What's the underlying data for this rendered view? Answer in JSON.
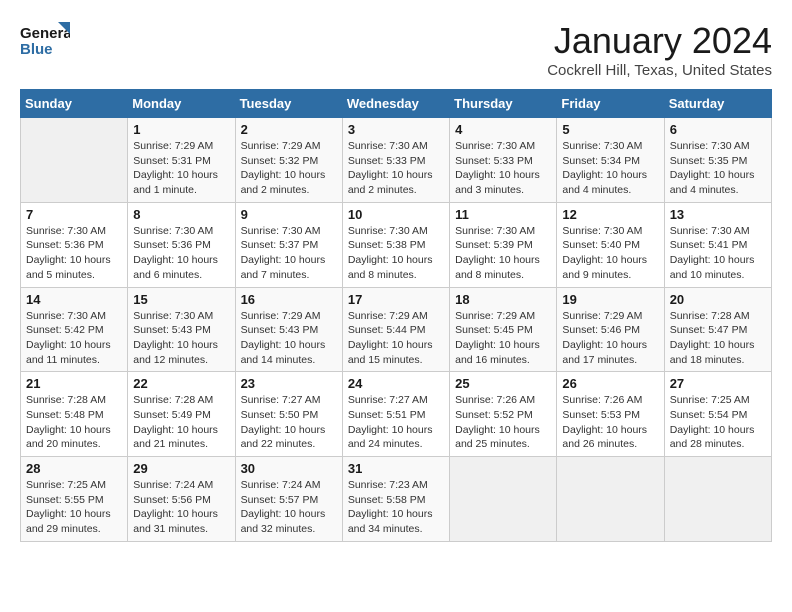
{
  "logo": {
    "line1": "General",
    "line2": "Blue"
  },
  "title": "January 2024",
  "subtitle": "Cockrell Hill, Texas, United States",
  "days_of_week": [
    "Sunday",
    "Monday",
    "Tuesday",
    "Wednesday",
    "Thursday",
    "Friday",
    "Saturday"
  ],
  "weeks": [
    [
      {
        "day": "",
        "info": ""
      },
      {
        "day": "1",
        "info": "Sunrise: 7:29 AM\nSunset: 5:31 PM\nDaylight: 10 hours\nand 1 minute."
      },
      {
        "day": "2",
        "info": "Sunrise: 7:29 AM\nSunset: 5:32 PM\nDaylight: 10 hours\nand 2 minutes."
      },
      {
        "day": "3",
        "info": "Sunrise: 7:30 AM\nSunset: 5:33 PM\nDaylight: 10 hours\nand 2 minutes."
      },
      {
        "day": "4",
        "info": "Sunrise: 7:30 AM\nSunset: 5:33 PM\nDaylight: 10 hours\nand 3 minutes."
      },
      {
        "day": "5",
        "info": "Sunrise: 7:30 AM\nSunset: 5:34 PM\nDaylight: 10 hours\nand 4 minutes."
      },
      {
        "day": "6",
        "info": "Sunrise: 7:30 AM\nSunset: 5:35 PM\nDaylight: 10 hours\nand 4 minutes."
      }
    ],
    [
      {
        "day": "7",
        "info": "Sunrise: 7:30 AM\nSunset: 5:36 PM\nDaylight: 10 hours\nand 5 minutes."
      },
      {
        "day": "8",
        "info": "Sunrise: 7:30 AM\nSunset: 5:36 PM\nDaylight: 10 hours\nand 6 minutes."
      },
      {
        "day": "9",
        "info": "Sunrise: 7:30 AM\nSunset: 5:37 PM\nDaylight: 10 hours\nand 7 minutes."
      },
      {
        "day": "10",
        "info": "Sunrise: 7:30 AM\nSunset: 5:38 PM\nDaylight: 10 hours\nand 8 minutes."
      },
      {
        "day": "11",
        "info": "Sunrise: 7:30 AM\nSunset: 5:39 PM\nDaylight: 10 hours\nand 8 minutes."
      },
      {
        "day": "12",
        "info": "Sunrise: 7:30 AM\nSunset: 5:40 PM\nDaylight: 10 hours\nand 9 minutes."
      },
      {
        "day": "13",
        "info": "Sunrise: 7:30 AM\nSunset: 5:41 PM\nDaylight: 10 hours\nand 10 minutes."
      }
    ],
    [
      {
        "day": "14",
        "info": "Sunrise: 7:30 AM\nSunset: 5:42 PM\nDaylight: 10 hours\nand 11 minutes."
      },
      {
        "day": "15",
        "info": "Sunrise: 7:30 AM\nSunset: 5:43 PM\nDaylight: 10 hours\nand 12 minutes."
      },
      {
        "day": "16",
        "info": "Sunrise: 7:29 AM\nSunset: 5:43 PM\nDaylight: 10 hours\nand 14 minutes."
      },
      {
        "day": "17",
        "info": "Sunrise: 7:29 AM\nSunset: 5:44 PM\nDaylight: 10 hours\nand 15 minutes."
      },
      {
        "day": "18",
        "info": "Sunrise: 7:29 AM\nSunset: 5:45 PM\nDaylight: 10 hours\nand 16 minutes."
      },
      {
        "day": "19",
        "info": "Sunrise: 7:29 AM\nSunset: 5:46 PM\nDaylight: 10 hours\nand 17 minutes."
      },
      {
        "day": "20",
        "info": "Sunrise: 7:28 AM\nSunset: 5:47 PM\nDaylight: 10 hours\nand 18 minutes."
      }
    ],
    [
      {
        "day": "21",
        "info": "Sunrise: 7:28 AM\nSunset: 5:48 PM\nDaylight: 10 hours\nand 20 minutes."
      },
      {
        "day": "22",
        "info": "Sunrise: 7:28 AM\nSunset: 5:49 PM\nDaylight: 10 hours\nand 21 minutes."
      },
      {
        "day": "23",
        "info": "Sunrise: 7:27 AM\nSunset: 5:50 PM\nDaylight: 10 hours\nand 22 minutes."
      },
      {
        "day": "24",
        "info": "Sunrise: 7:27 AM\nSunset: 5:51 PM\nDaylight: 10 hours\nand 24 minutes."
      },
      {
        "day": "25",
        "info": "Sunrise: 7:26 AM\nSunset: 5:52 PM\nDaylight: 10 hours\nand 25 minutes."
      },
      {
        "day": "26",
        "info": "Sunrise: 7:26 AM\nSunset: 5:53 PM\nDaylight: 10 hours\nand 26 minutes."
      },
      {
        "day": "27",
        "info": "Sunrise: 7:25 AM\nSunset: 5:54 PM\nDaylight: 10 hours\nand 28 minutes."
      }
    ],
    [
      {
        "day": "28",
        "info": "Sunrise: 7:25 AM\nSunset: 5:55 PM\nDaylight: 10 hours\nand 29 minutes."
      },
      {
        "day": "29",
        "info": "Sunrise: 7:24 AM\nSunset: 5:56 PM\nDaylight: 10 hours\nand 31 minutes."
      },
      {
        "day": "30",
        "info": "Sunrise: 7:24 AM\nSunset: 5:57 PM\nDaylight: 10 hours\nand 32 minutes."
      },
      {
        "day": "31",
        "info": "Sunrise: 7:23 AM\nSunset: 5:58 PM\nDaylight: 10 hours\nand 34 minutes."
      },
      {
        "day": "",
        "info": ""
      },
      {
        "day": "",
        "info": ""
      },
      {
        "day": "",
        "info": ""
      }
    ]
  ]
}
